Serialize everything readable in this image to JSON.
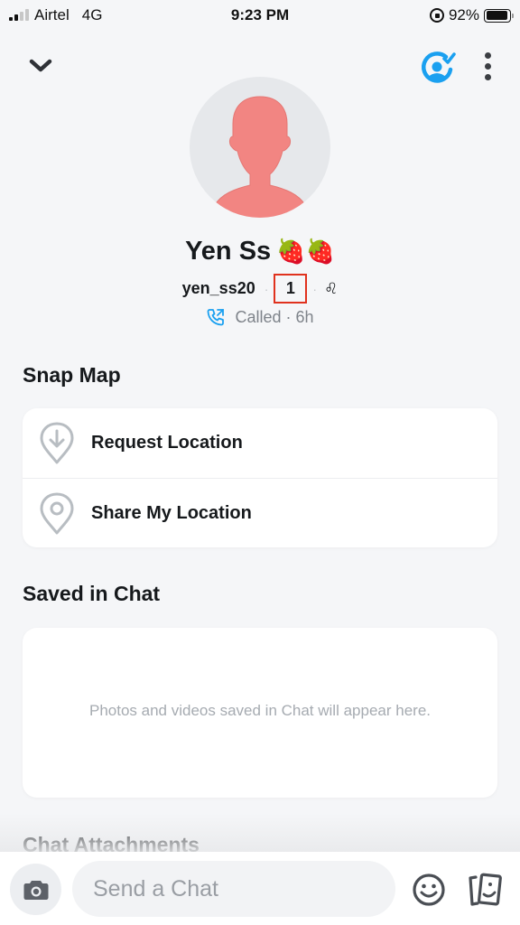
{
  "status_bar": {
    "carrier": "Airtel",
    "network": "4G",
    "time": "9:23 PM",
    "battery_percent": "92%",
    "battery_level": 0.92,
    "signal_bars_on": 2,
    "signal_bars_total": 4
  },
  "profile": {
    "display_name": "Yen Ss",
    "name_emojis": "🍓🍓",
    "username": "yen_ss20",
    "snap_score": "1",
    "zodiac": "♌",
    "call_status": "Called",
    "call_time": "6h",
    "separator": "·",
    "avatar_color": "#f28582"
  },
  "snap_map": {
    "title": "Snap Map",
    "items": [
      {
        "label": "Request Location",
        "icon": "location-pin-down-arrow-icon"
      },
      {
        "label": "Share My Location",
        "icon": "location-pin-icon"
      }
    ]
  },
  "saved_in_chat": {
    "title": "Saved in Chat",
    "empty_message": "Photos and videos saved in Chat will appear here."
  },
  "chat_attachments": {
    "title": "Chat Attachments"
  },
  "chat_bar": {
    "placeholder": "Send a Chat"
  },
  "colors": {
    "accent_blue": "#1aa0f0",
    "highlight_red": "#e0321e",
    "background": "#f5f6f8"
  }
}
